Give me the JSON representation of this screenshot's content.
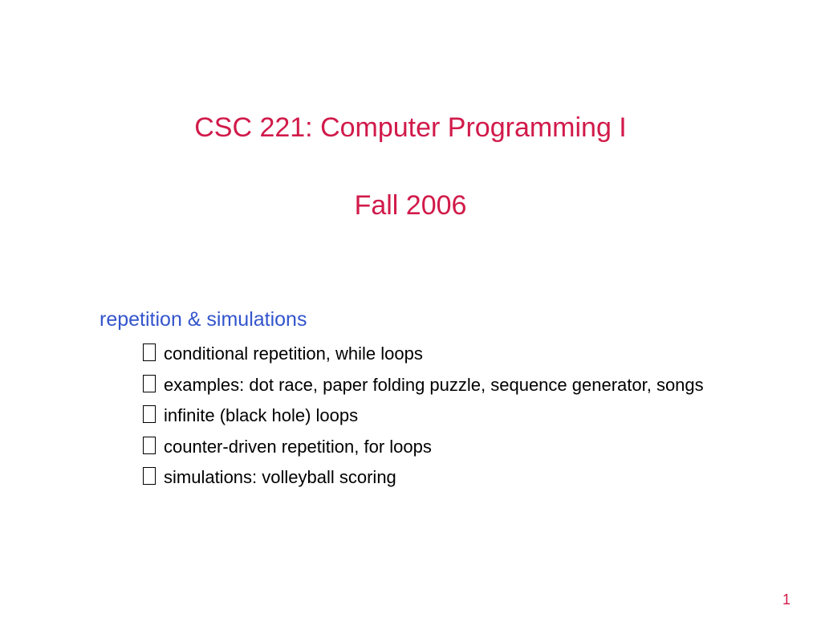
{
  "title": {
    "main": "CSC 221: Computer Programming I",
    "sub": "Fall 2006"
  },
  "section": {
    "heading": "repetition & simulations",
    "items": [
      "conditional repetition, while loops",
      "examples: dot race, paper folding puzzle, sequence generator, songs",
      "infinite (black hole) loops",
      "counter-driven repetition, for loops",
      "simulations: volleyball scoring"
    ]
  },
  "page_number": "1"
}
